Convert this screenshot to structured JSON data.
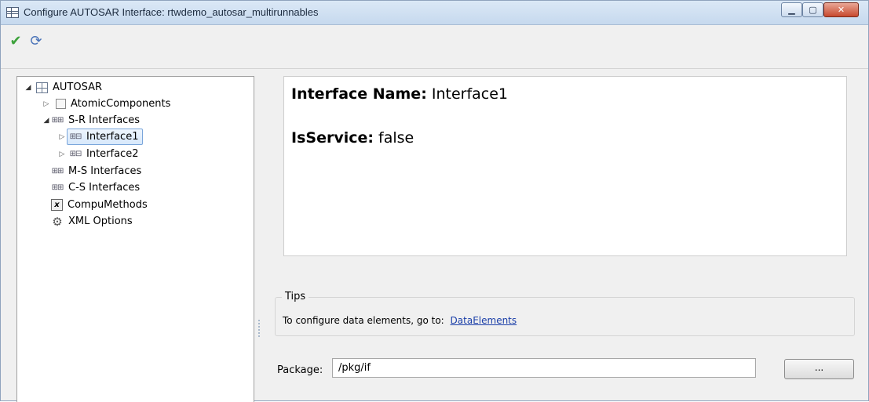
{
  "window": {
    "title": "Configure AUTOSAR Interface: rtwdemo_autosar_multirunnables",
    "controls": {
      "minimize": "▁",
      "maximize": "▢",
      "close": "✕"
    }
  },
  "toolbar": {
    "apply_icon": "check-icon",
    "refresh_icon": "refresh-icon"
  },
  "tree": {
    "root": "AUTOSAR",
    "items": {
      "atomic": "AtomicComponents",
      "sr": "S-R Interfaces",
      "iface1": "Interface1",
      "iface2": "Interface2",
      "ms": "M-S Interfaces",
      "cs": "C-S Interfaces",
      "compu": "CompuMethods",
      "xml": "XML Options"
    },
    "selected": "Interface1"
  },
  "details": {
    "name_key": "Interface Name:",
    "name_value": "Interface1",
    "service_key": "IsService:",
    "service_value": "false"
  },
  "tips": {
    "legend": "Tips",
    "text": "To configure data elements, go to:",
    "link": "DataElements"
  },
  "package": {
    "label": "Package:",
    "value": "/pkg/if",
    "browse_label": "..."
  },
  "colors": {
    "selection_bg": "#d7e8fb",
    "selection_border": "#7aa6db",
    "link": "#1a3ea8",
    "close_button": "#c7492e"
  }
}
